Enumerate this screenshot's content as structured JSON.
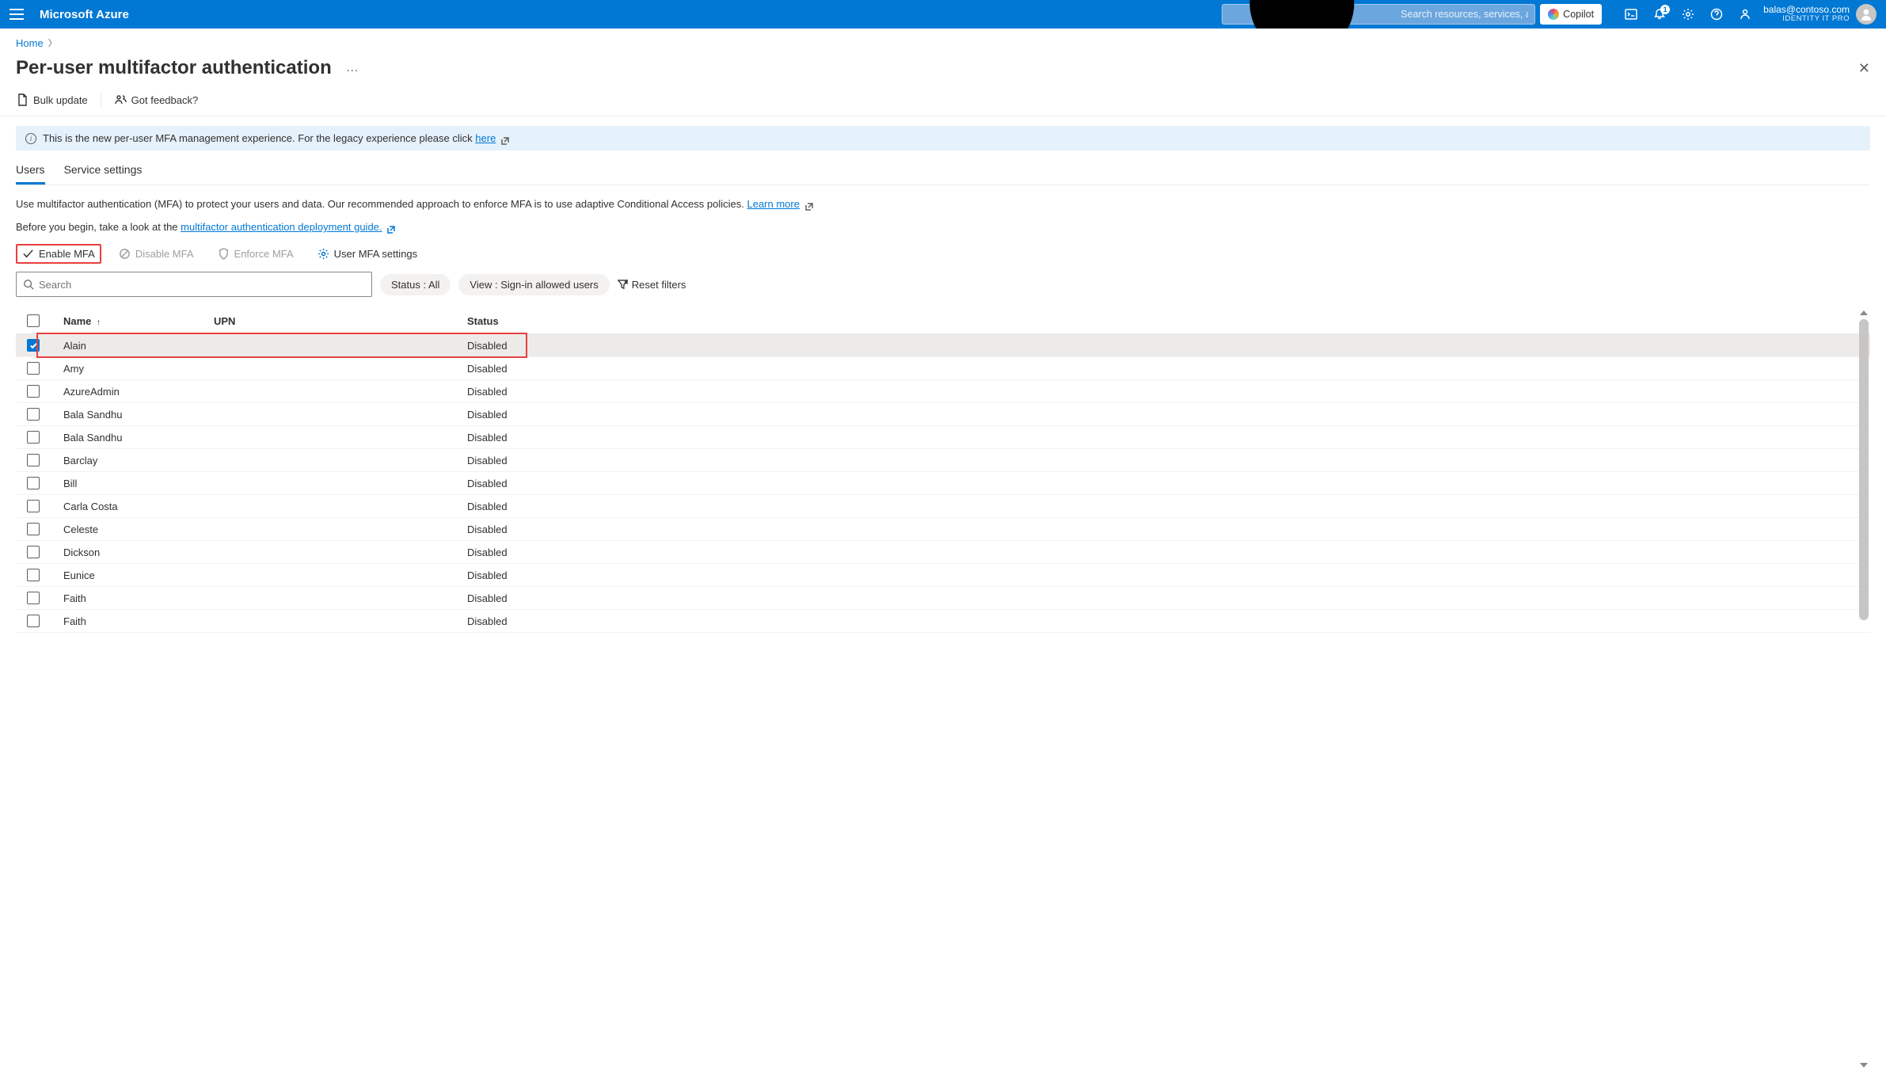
{
  "header": {
    "brand": "Microsoft Azure",
    "search_placeholder": "Search resources, services, and docs (G+/)",
    "copilot": "Copilot",
    "notif_count": "1",
    "user_email": "balas@contoso.com",
    "user_tenant": "IDENTITY IT PRO"
  },
  "breadcrumb": {
    "home": "Home"
  },
  "page_title": "Per-user multifactor authentication",
  "toolbar": {
    "bulk_update": "Bulk update",
    "got_feedback": "Got feedback?"
  },
  "banner": {
    "text_prefix": "This is the new per-user MFA management experience. For the legacy experience please click ",
    "link": "here"
  },
  "tabs": {
    "users": "Users",
    "service": "Service settings"
  },
  "descriptions": {
    "line1_pre": "Use multifactor authentication (MFA) to protect your users and data. Our recommended approach to enforce MFA is to use adaptive Conditional Access policies. ",
    "learn_more": "Learn more",
    "line2_pre": "Before you begin, take a look at the ",
    "guide_link": "multifactor authentication deployment guide."
  },
  "actions": {
    "enable": "Enable MFA",
    "disable": "Disable MFA",
    "enforce": "Enforce MFA",
    "settings": "User MFA settings"
  },
  "filters": {
    "search_placeholder": "Search",
    "status": "Status : All",
    "view": "View : Sign-in allowed users",
    "reset": "Reset filters"
  },
  "table": {
    "headers": {
      "name": "Name",
      "upn": "UPN",
      "status": "Status"
    },
    "sort_indicator": "↑",
    "rows": [
      {
        "name": "Alain",
        "upn": "",
        "status": "Disabled",
        "checked": true,
        "highlighted": true
      },
      {
        "name": "Amy",
        "upn": "",
        "status": "Disabled",
        "checked": false
      },
      {
        "name": "AzureAdmin",
        "upn": "",
        "status": "Disabled",
        "checked": false
      },
      {
        "name": "Bala Sandhu",
        "upn": "",
        "status": "Disabled",
        "checked": false
      },
      {
        "name": "Bala Sandhu",
        "upn": "",
        "status": "Disabled",
        "checked": false
      },
      {
        "name": "Barclay",
        "upn": "",
        "status": "Disabled",
        "checked": false
      },
      {
        "name": "Bill",
        "upn": "",
        "status": "Disabled",
        "checked": false
      },
      {
        "name": "Carla Costa",
        "upn": "",
        "status": "Disabled",
        "checked": false
      },
      {
        "name": "Celeste",
        "upn": "",
        "status": "Disabled",
        "checked": false
      },
      {
        "name": "Dickson",
        "upn": "",
        "status": "Disabled",
        "checked": false
      },
      {
        "name": "Eunice",
        "upn": "",
        "status": "Disabled",
        "checked": false
      },
      {
        "name": "Faith",
        "upn": "",
        "status": "Disabled",
        "checked": false
      },
      {
        "name": "Faith",
        "upn": "",
        "status": "Disabled",
        "checked": false
      }
    ]
  }
}
